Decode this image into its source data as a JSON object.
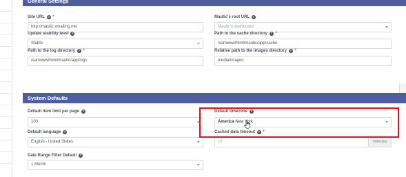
{
  "top_panel": {
    "heading": "General Settings",
    "fields": {
      "site_url": {
        "label": "Site URL",
        "required": "*",
        "value": "http://mautic.xmailing.me"
      },
      "root_url": {
        "label": "Mautic's root URL",
        "placeholder": "Mautic's dashboard"
      },
      "stability": {
        "label": "Update stability level",
        "value": "Stable"
      },
      "cache_dir": {
        "label": "Path to the cache directory",
        "required": "*",
        "value": "/var/www/html/mautic/app/cache"
      },
      "log_dir": {
        "label": "Path to the log directory",
        "required": "*",
        "value": "/var/www/html/mautic/app/logs"
      },
      "images_dir": {
        "label": "Relative path to the images directory",
        "required": "*",
        "value": "media/images"
      }
    }
  },
  "system_defaults": {
    "heading": "System Defaults",
    "fields": {
      "item_limit": {
        "label": "Default item limit per page",
        "value": "100"
      },
      "timezone": {
        "label": "Default timezone",
        "value_bold": "America",
        "value_rest": "New York"
      },
      "language": {
        "label": "Default language",
        "value": "English - United States"
      },
      "cache_timeout": {
        "label": "Cached data timeout",
        "required": "*",
        "value": "10",
        "unit": "minutes"
      },
      "date_range": {
        "label": "Date Range Filter Default",
        "value": "1 Month"
      }
    }
  },
  "icons": {
    "help": "?"
  },
  "colors": {
    "panel_heading": "#4e5d9d",
    "highlight": "#e0101c",
    "required": "#d9534f"
  }
}
